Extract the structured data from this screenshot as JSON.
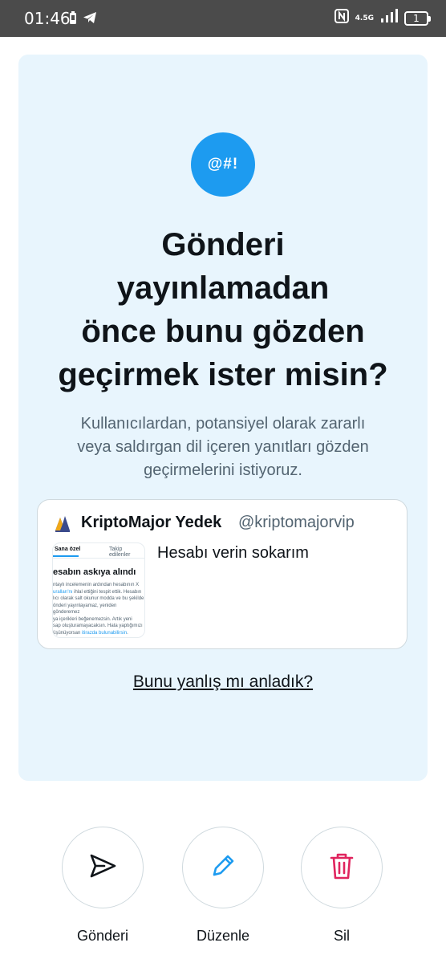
{
  "status_bar": {
    "time": "01:46",
    "network": "4.5G",
    "battery": "1"
  },
  "dialog": {
    "badge_text": "@#!",
    "title_lines": [
      "Gönderi",
      "yayınlamadan",
      "önce bunu gözden",
      "geçirmek ister misin?"
    ],
    "subtitle_lines": [
      "Kullanıcılardan, potansiyel olarak zararlı",
      "veya saldırgan dil içeren yanıtları gözden",
      "geçirmelerini istiyoruz."
    ],
    "tweet": {
      "name": "KriptoMajor Yedek",
      "handle": "@kriptomajorvip",
      "text": "Hesabı verin sokarım",
      "attachment": {
        "tab_1": "Sana özel",
        "tab_2": "Takip edilenler",
        "heading": "esabın askıya alındı",
        "body_1": "ntaylı incelemenin ardından hesabının X",
        "body_2": "uralları'nı",
        "body_3": " ihlal ettiğini tespit ettik. Hesabın",
        "body_4": "lıcı olarak salt okunur modda ve bu şekilde",
        "body_5": "önderi yayınlayamaz, yeniden gönderemez",
        "body_6": "ya içerikleri beğenemezsin. Artık yeni",
        "body_7": "sap oluşturamayacaksın. Hata yaptığımızı",
        "body_8": "üşünüyorsan",
        "body_9": "itirazda bulunabilirsin",
        "body_10": "."
      }
    },
    "feedback_link": "Bunu yanlış mı anladık?"
  },
  "actions": {
    "send": {
      "label": "Gönderi",
      "icon": "send-icon"
    },
    "edit": {
      "label": "Düzenle",
      "icon": "pencil-icon"
    },
    "delete": {
      "label": "Sil",
      "icon": "trash-icon"
    }
  },
  "colors": {
    "accent": "#1d9bf0",
    "card_bg": "#e8f5fd",
    "delete": "#e0245e",
    "status_bar": "#4b4b4b"
  }
}
